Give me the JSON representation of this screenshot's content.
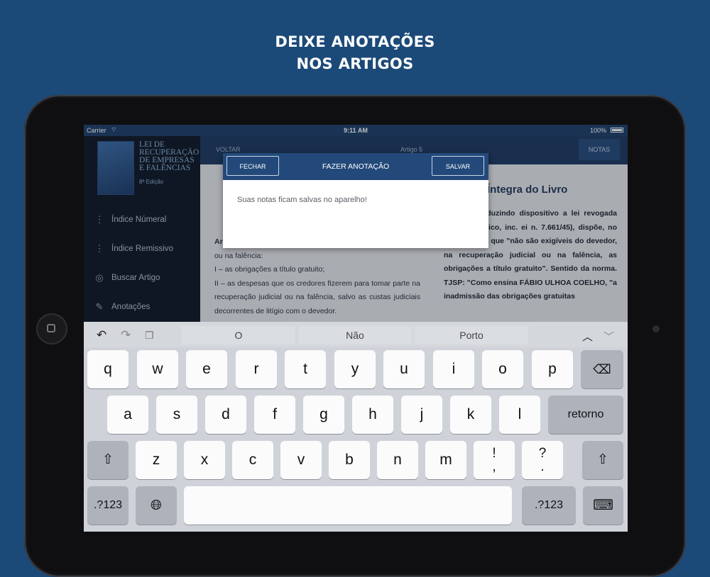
{
  "headline": {
    "line1": "DEIXE ANOTAÇÕES",
    "line2": "NOS ARTIGOS"
  },
  "status_bar": {
    "carrier": "Carrier",
    "time": "9:11 AM",
    "battery": "100%"
  },
  "sidebar": {
    "book": {
      "title": "LEI DE RECUPERAÇÃO DE EMPRESAS E FALÊNCIAS",
      "edition": "8ª Edição"
    },
    "items": [
      {
        "label": "Índice Númeral",
        "icon": "numeric-list-icon"
      },
      {
        "label": "Índice Remissivo",
        "icon": "alpha-list-icon"
      },
      {
        "label": "Buscar Artigo",
        "icon": "search-article-icon"
      },
      {
        "label": "Anotações",
        "icon": "edit-note-icon"
      }
    ]
  },
  "topbar": {
    "back": "VOLTAR",
    "article": "Artigo 5",
    "notes": "NOTAS"
  },
  "article_left": {
    "lines": [
      "Ar",
      "ou na falência:",
      "I – as obrigações a título gratuito;",
      "II – as despesas que os credores fizerem para tomar parte na recuperação judicial ou na falência, salvo as custas judiciais decorrentes de litígio com o devedor."
    ]
  },
  "article_right": {
    "title": "Íntegra do Livro",
    "text": "atual, reproduzindo dispositivo a lei revogada (art. 23, §único, inc. ei n. 7.661/45), dispõe, no art. 5º, inc. I, que \"não são exigíveis do devedor, na recuperação judicial ou na falência, as obrigações a título gratuito\". Sentido da norma. TJSP: \"Como ensina FÁBIO ULHOA COELHO, \"a inadmissão das obrigações gratuitas"
  },
  "modal": {
    "close": "FECHAR",
    "title": "FAZER ANOTAÇÃO",
    "save": "SALVAR",
    "value": "Suas notas ficam salvas no aparelho!"
  },
  "keyboard": {
    "suggestions": [
      "O",
      "Não",
      "Porto"
    ],
    "row1": [
      "q",
      "w",
      "e",
      "r",
      "t",
      "y",
      "u",
      "i",
      "o",
      "p"
    ],
    "row2": [
      "a",
      "s",
      "d",
      "f",
      "g",
      "h",
      "j",
      "k",
      "l"
    ],
    "row3": [
      "z",
      "x",
      "c",
      "v",
      "b",
      "n",
      "m"
    ],
    "punct1": [
      "!",
      ","
    ],
    "punct2": [
      "?",
      "."
    ],
    "return": "retorno",
    "numbers": ".?123"
  }
}
